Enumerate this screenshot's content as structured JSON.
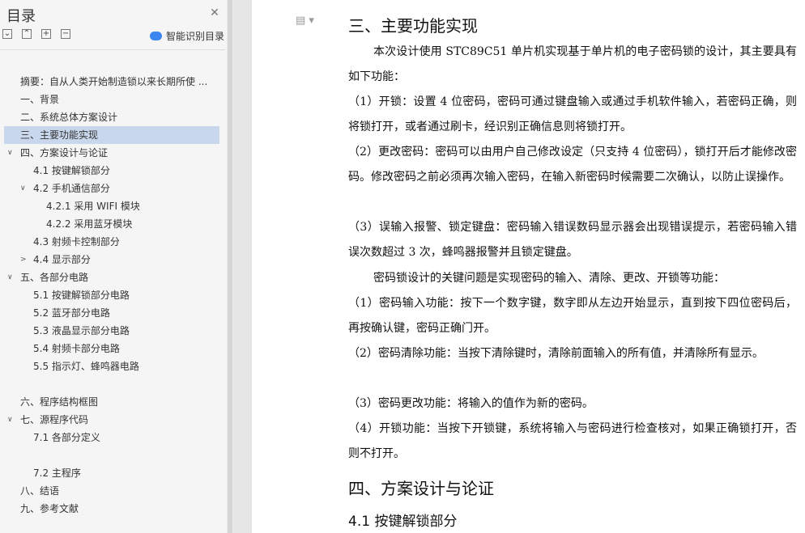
{
  "toc": {
    "title": "目录",
    "smart_label": "智能识别目录",
    "items": [
      "摘要：自从人类开始制造锁以来长期所使 ...",
      "一、背景",
      "二、系统总体方案设计",
      "三、主要功能实现",
      "四、方案设计与论证",
      "4.1 按键解锁部分",
      "4.2 手机通信部分",
      "4.2.1  采用 WIFI 模块",
      "4.2.2  采用蓝牙模块",
      "4.3 射频卡控制部分",
      "4.4 显示部分",
      "五、各部分电路",
      "5.1 按键解锁部分电路",
      "5.2 蓝牙部分电路",
      "5.3 液晶显示部分电路",
      "5.4 射频卡部分电路",
      "5.5 指示灯、蜂鸣器电路",
      "六、程序结构框图",
      "七、源程序代码",
      "7.1 各部分定义",
      "7.2 主程序",
      "八、结语",
      "九、参考文献"
    ],
    "selected": "三、主要功能实现"
  },
  "document": {
    "heading_3": "三、主要功能实现",
    "paragraphs": [
      "本次设计使用 STC89C51 单片机实现基于单片机的电子密码锁的设计，其主要具有如下功能：",
      "（1）开锁：设置 4 位密码，密码可通过键盘输入或通过手机软件输入，若密码正确，则将锁打开，或者通过刷卡，经识别正确信息则将锁打开。",
      "（2）更改密码：密码可以由用户自己修改设定（只支持 4 位密码），锁打开后才能修改密码。修改密码之前必须再次输入密码，在输入新密码时候需要二次确认，以防止误操作。",
      "（3）误输入报警、锁定键盘：密码输入错误数码显示器会出现错误提示，若密码输入错误次数超过 3 次，蜂鸣器报警并且锁定键盘。",
      "密码锁设计的关键问题是实现密码的输入、清除、更改、开锁等功能：",
      "（1）密码输入功能：按下一个数字键，数字即从左边开始显示，直到按下四位密码后，再按确认键，密码正确门开。",
      "（2）密码清除功能：当按下清除键时，清除前面输入的所有值，并清除所有显示。",
      "（3）密码更改功能：将输入的值作为新的密码。",
      "（4）开锁功能：当按下开锁键，系统将输入与密码进行检查核对，如果正确锁打开，否则不打开。"
    ],
    "heading_4": "四、方案设计与论证",
    "heading_41": "4.1 按键解锁部分"
  }
}
